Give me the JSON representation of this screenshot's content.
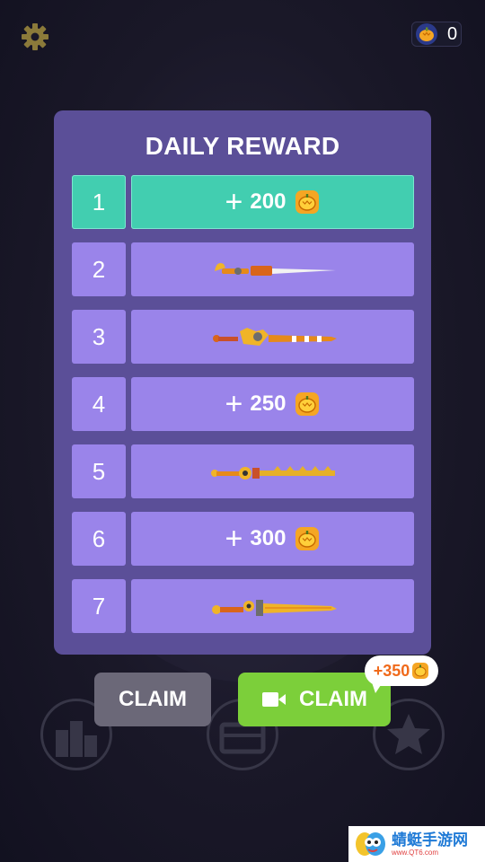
{
  "header": {
    "settings_icon": "gear-icon",
    "coin_icon": "pumpkin-coin-icon",
    "coin_count": "0"
  },
  "panel": {
    "title": "DAILY REWARD",
    "rows": [
      {
        "day": "1",
        "type": "coins",
        "plus": "+",
        "amount": "200",
        "active": true
      },
      {
        "day": "2",
        "type": "item",
        "icon": "sword-icon"
      },
      {
        "day": "3",
        "type": "item",
        "icon": "sword-icon"
      },
      {
        "day": "4",
        "type": "coins",
        "plus": "+",
        "amount": "250"
      },
      {
        "day": "5",
        "type": "item",
        "icon": "sword-icon"
      },
      {
        "day": "6",
        "type": "coins",
        "plus": "+",
        "amount": "300"
      },
      {
        "day": "7",
        "type": "item",
        "icon": "sword-icon"
      }
    ]
  },
  "buttons": {
    "claim_label": "CLAIM",
    "video_claim_label": "CLAIM",
    "bonus_label": "+350"
  },
  "watermark": {
    "title": "蜻蜓手游网",
    "url": "www.QT6.com"
  },
  "colors": {
    "panel": "#5b4f98",
    "row": "#9a84ea",
    "active_row": "#42ceb0",
    "claim": "#6b6878",
    "video_claim": "#7ccf3a",
    "coin": "#f5a623"
  }
}
